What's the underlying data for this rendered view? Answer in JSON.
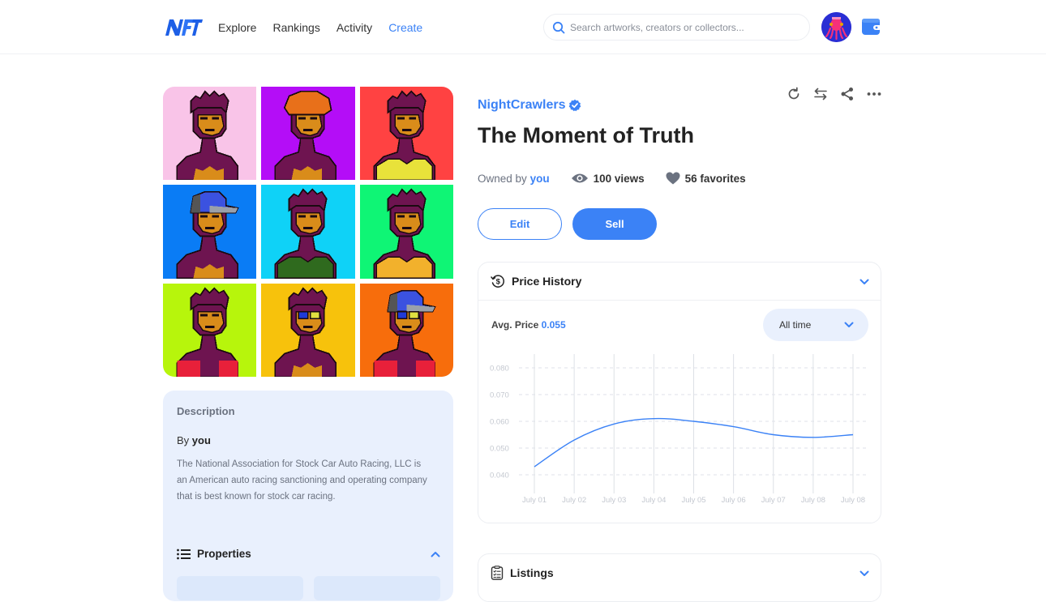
{
  "header": {
    "logo_text": "NFT",
    "nav": [
      {
        "label": "Explore",
        "active": false
      },
      {
        "label": "Rankings",
        "active": false
      },
      {
        "label": "Activity",
        "active": false
      },
      {
        "label": "Create",
        "active": true
      }
    ],
    "search_placeholder": "Search artworks, creators or collectors...",
    "avatar_icon": "octopus-avatar",
    "wallet_icon": "wallet-icon"
  },
  "artwork": {
    "tiles": [
      {
        "bg": "#f9c4e8",
        "variant": "plain"
      },
      {
        "bg": "#b40df7",
        "variant": "orange-hair"
      },
      {
        "bg": "#ff4242",
        "variant": "yellow-top"
      },
      {
        "bg": "#0a7cf5",
        "variant": "cap"
      },
      {
        "bg": "#0fd2f7",
        "variant": "green-shirt"
      },
      {
        "bg": "#0ff575",
        "variant": "yellow-shirt"
      },
      {
        "bg": "#b7f50c",
        "variant": "check-shirt"
      },
      {
        "bg": "#f7c20c",
        "variant": "glasses"
      },
      {
        "bg": "#f76d0c",
        "variant": "cap-glasses"
      }
    ]
  },
  "description": {
    "heading": "Description",
    "by_prefix": "By",
    "by_name": "you",
    "text": "The National Association for Stock Car Auto Racing, LLC is an American auto racing sanctioning and operating company that is best known for stock car racing.",
    "properties_label": "Properties"
  },
  "item": {
    "collection": "NightCrawlers",
    "verified": true,
    "title": "The Moment of Truth",
    "owned_prefix": "Owned by",
    "owner": "you",
    "views": "100 views",
    "favorites": "56 favorites",
    "toolbar_icons": [
      "refresh-icon",
      "transfer-icon",
      "share-icon",
      "more-icon"
    ]
  },
  "actions": {
    "edit_label": "Edit",
    "sell_label": "Sell"
  },
  "price_history": {
    "title": "Price History",
    "avg_label": "Avg. Price",
    "avg_value": "0.055",
    "period": "All time"
  },
  "listings": {
    "title": "Listings"
  },
  "colors": {
    "accent": "#3b82f6",
    "text": "#222222",
    "muted": "#6b7280",
    "panel": "#e9f0fd"
  },
  "chart_data": {
    "type": "line",
    "title": "Price History",
    "xlabel": "",
    "ylabel": "",
    "categories": [
      "July 01",
      "July 02",
      "July 03",
      "July 04",
      "July 05",
      "July 06",
      "July 07",
      "July 08",
      "July 08"
    ],
    "series": [
      {
        "name": "Price",
        "values": [
          0.043,
          0.053,
          0.059,
          0.061,
          0.06,
          0.058,
          0.055,
          0.054,
          0.055
        ]
      }
    ],
    "yticks": [
      "0.080",
      "0.070",
      "0.060",
      "0.050",
      "0.040"
    ],
    "ylim": [
      0.04,
      0.08
    ],
    "grid": true,
    "legend": "none",
    "line_color": "#3b82f6"
  }
}
